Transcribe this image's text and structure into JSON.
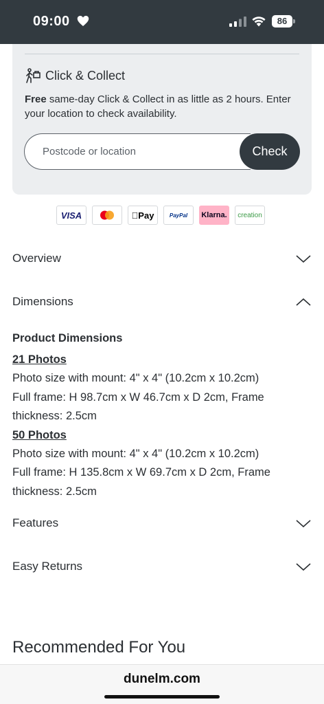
{
  "status_bar": {
    "time": "09:00",
    "battery": "86",
    "icons": [
      "heart-icon",
      "signal-icon",
      "wifi-icon",
      "battery-icon"
    ]
  },
  "click_collect": {
    "title": "Click & Collect",
    "description_bold": "Free",
    "description_rest": " same-day Click & Collect in as little as 2 hours. Enter your location to check availability.",
    "input_placeholder": "Postcode or location",
    "input_value": "",
    "check_label": "Check"
  },
  "payments": {
    "visa": "VISA",
    "apple_pay": "Pay",
    "paypal": "PayPal",
    "klarna": "Klarna.",
    "creation": "creation"
  },
  "accordions": {
    "overview": "Overview",
    "dimensions": "Dimensions",
    "features": "Features",
    "easy_returns": "Easy Returns"
  },
  "dimensions": {
    "heading": "Product Dimensions",
    "groups": [
      {
        "title": "21 Photos",
        "line1": "Photo size with mount: 4\" x 4\" (10.2cm x 10.2cm)",
        "line2": "Full frame: H 98.7cm x W 46.7cm x D 2cm, Frame",
        "line3": "thickness: 2.5cm"
      },
      {
        "title": "50 Photos",
        "line1": "Photo size with mount: 4\" x 4\" (10.2cm x 10.2cm)",
        "line2": "Full frame: H 135.8cm x W 69.7cm x D 2cm, Frame",
        "line3": "thickness: 2.5cm"
      }
    ]
  },
  "recommended_title": "Recommended For You",
  "browser": {
    "url": "dunelm.com"
  },
  "colors": {
    "status_bar_bg": "#323a40",
    "panel_bg": "#eceef0",
    "button_bg": "#323a40",
    "text": "#2b2f33"
  }
}
